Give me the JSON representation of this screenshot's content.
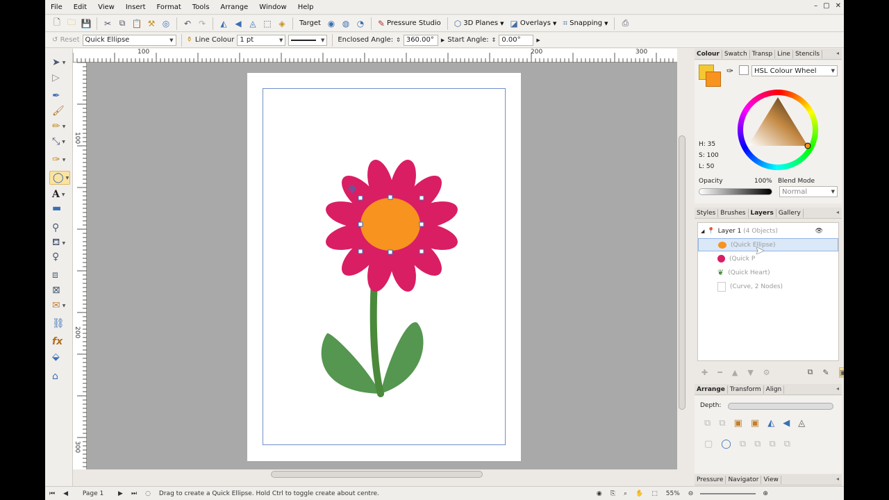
{
  "menu": [
    "File",
    "Edit",
    "View",
    "Insert",
    "Format",
    "Tools",
    "Arrange",
    "Window",
    "Help"
  ],
  "window_controls": [
    "–",
    "▢",
    "✕"
  ],
  "toolbar": {
    "target": "Target",
    "pressure_studio": "Pressure Studio",
    "planes": "3D Planes",
    "overlays": "Overlays",
    "snapping": "Snapping"
  },
  "context": {
    "reset": "Reset",
    "shape": "Quick Ellipse",
    "line_colour_label": "Line Colour",
    "line_width": "1 pt",
    "enclosed_angle_label": "Enclosed Angle:",
    "enclosed_angle": "360.00°",
    "start_angle_label": "Start Angle:",
    "start_angle": "0.00°"
  },
  "ruler": {
    "h_labels": [
      "100",
      "200",
      "300"
    ],
    "v_labels": [
      "100",
      "200",
      "300"
    ]
  },
  "colour_panel": {
    "tabs": [
      "Colour",
      "Swatch",
      "Transp",
      "Line",
      "Stencils"
    ],
    "model": "HSL Colour Wheel",
    "h": "H: 35",
    "s": "S: 100",
    "l": "L: 50",
    "opacity_label": "Opacity",
    "opacity_value": "100%",
    "blend_label": "Blend Mode",
    "blend_value": "Normal"
  },
  "layers_panel": {
    "tabs": [
      "Styles",
      "Brushes",
      "Layers",
      "Gallery"
    ],
    "layer_name": "Layer 1",
    "layer_count": "(4 Objects)",
    "objects": [
      {
        "label": "(Quick Ellipse)",
        "color": "#f7931e"
      },
      {
        "label": "(Quick P",
        "color": "#d91e64"
      },
      {
        "label": "(Quick Heart)",
        "color": "#4a8a3a"
      },
      {
        "label": "(Curve, 2 Nodes)",
        "color": "#ffffff"
      }
    ]
  },
  "arrange_panel": {
    "tabs": [
      "Arrange",
      "Transform",
      "Align"
    ],
    "depth_label": "Depth:"
  },
  "bottom_panel_tabs": [
    "Pressure",
    "Navigator",
    "View"
  ],
  "status": {
    "page": "Page 1",
    "hint": "Drag to create a Quick Ellipse. Hold Ctrl to toggle create about centre.",
    "zoom": "55%"
  },
  "colors": {
    "petal": "#d91e64",
    "center": "#f7931e",
    "leaf": "#559650",
    "stem": "#4a8a3a"
  }
}
